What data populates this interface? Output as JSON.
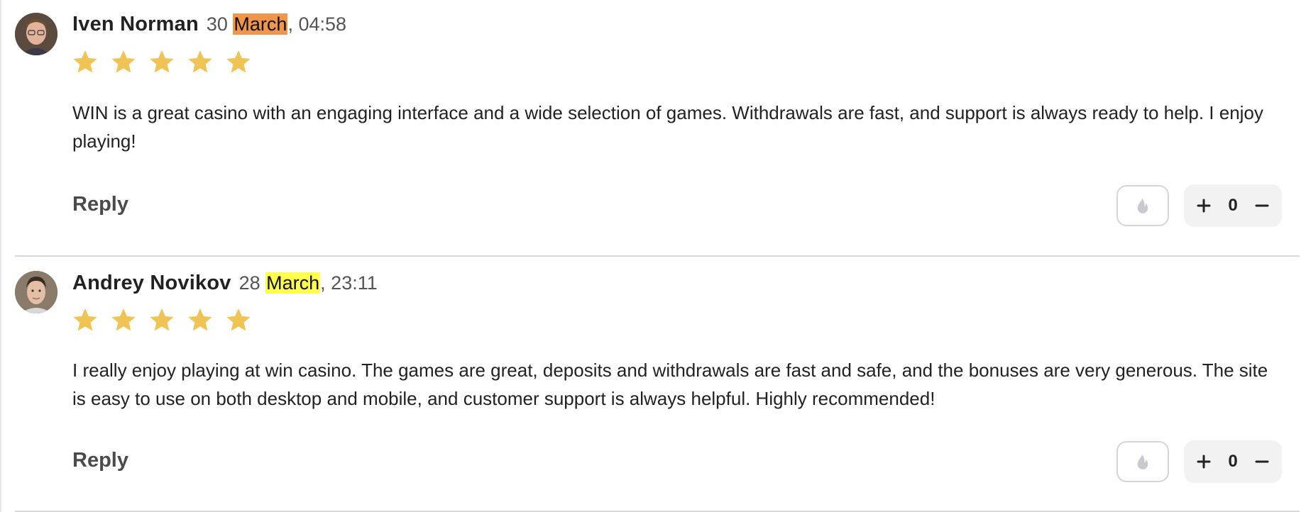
{
  "colors": {
    "star": "#f0c454",
    "highlight_orange": "#f0954a",
    "highlight_yellow": "#ffff4d",
    "fire_icon": "#c9c9cf",
    "vote_bg": "#f2f2f3"
  },
  "comments": [
    {
      "author": "Iven Norman",
      "date_day": "30",
      "date_month": "March",
      "date_time": ", 04:58",
      "rating": 5,
      "text": "WIN is a great casino with an engaging interface and a wide selection of games. Withdrawals are fast, and support is always ready to help. I enjoy playing!",
      "reply_label": "Reply",
      "votes": "0",
      "icons": {
        "react": "fire-icon",
        "plus": "plus-icon",
        "minus": "minus-icon"
      }
    },
    {
      "author": "Andrey Novikov",
      "date_day": "28",
      "date_month": "March",
      "date_time": ", 23:11",
      "rating": 5,
      "text": "I really enjoy playing at win casino. The games are great, deposits and withdrawals are fast and safe, and the bonuses are very generous. The site is easy to use on both desktop and mobile, and customer support is always helpful. Highly recommended!",
      "reply_label": "Reply",
      "votes": "0",
      "icons": {
        "react": "fire-icon",
        "plus": "plus-icon",
        "minus": "minus-icon"
      }
    }
  ]
}
